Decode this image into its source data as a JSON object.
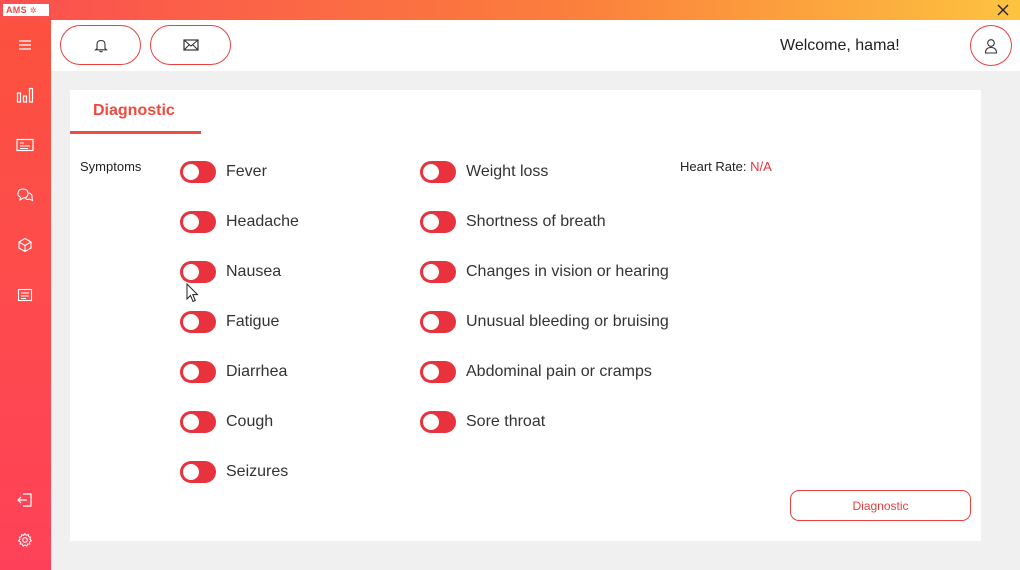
{
  "app": {
    "logo_text": "AMS",
    "logo_sub": "✲"
  },
  "topbar": {
    "welcome": "Welcome, hama!"
  },
  "sidebar": {
    "items": [
      {
        "name": "menu",
        "icon": "hamburger-icon"
      },
      {
        "name": "stats",
        "icon": "bar-chart-icon"
      },
      {
        "name": "records",
        "icon": "id-card-icon"
      },
      {
        "name": "chat",
        "icon": "chat-bubbles-icon"
      },
      {
        "name": "diagnostic",
        "icon": "cube-icon"
      },
      {
        "name": "notes",
        "icon": "document-icon"
      },
      {
        "name": "logout",
        "icon": "logout-icon"
      },
      {
        "name": "settings",
        "icon": "gear-icon"
      }
    ]
  },
  "diagnostic": {
    "tab_label": "Diagnostic",
    "symptoms_label": "Symptoms",
    "heart_rate_label": "Heart Rate:",
    "heart_rate_value": "N/A",
    "button_label": "Diagnostic",
    "column1": [
      "Fever",
      "Headache",
      "Nausea",
      "Fatigue",
      "Diarrhea",
      "Cough",
      "Seizures"
    ],
    "column2": [
      "Weight loss",
      "Shortness of breath",
      "Changes in vision or hearing",
      "Unusual bleeding or bruising",
      "Abdominal pain or cramps",
      "Sore throat"
    ]
  },
  "colors": {
    "accent": "#e8333f",
    "brand_gradient_start": "#fb4f4f",
    "brand_gradient_end": "#fdc33f"
  }
}
